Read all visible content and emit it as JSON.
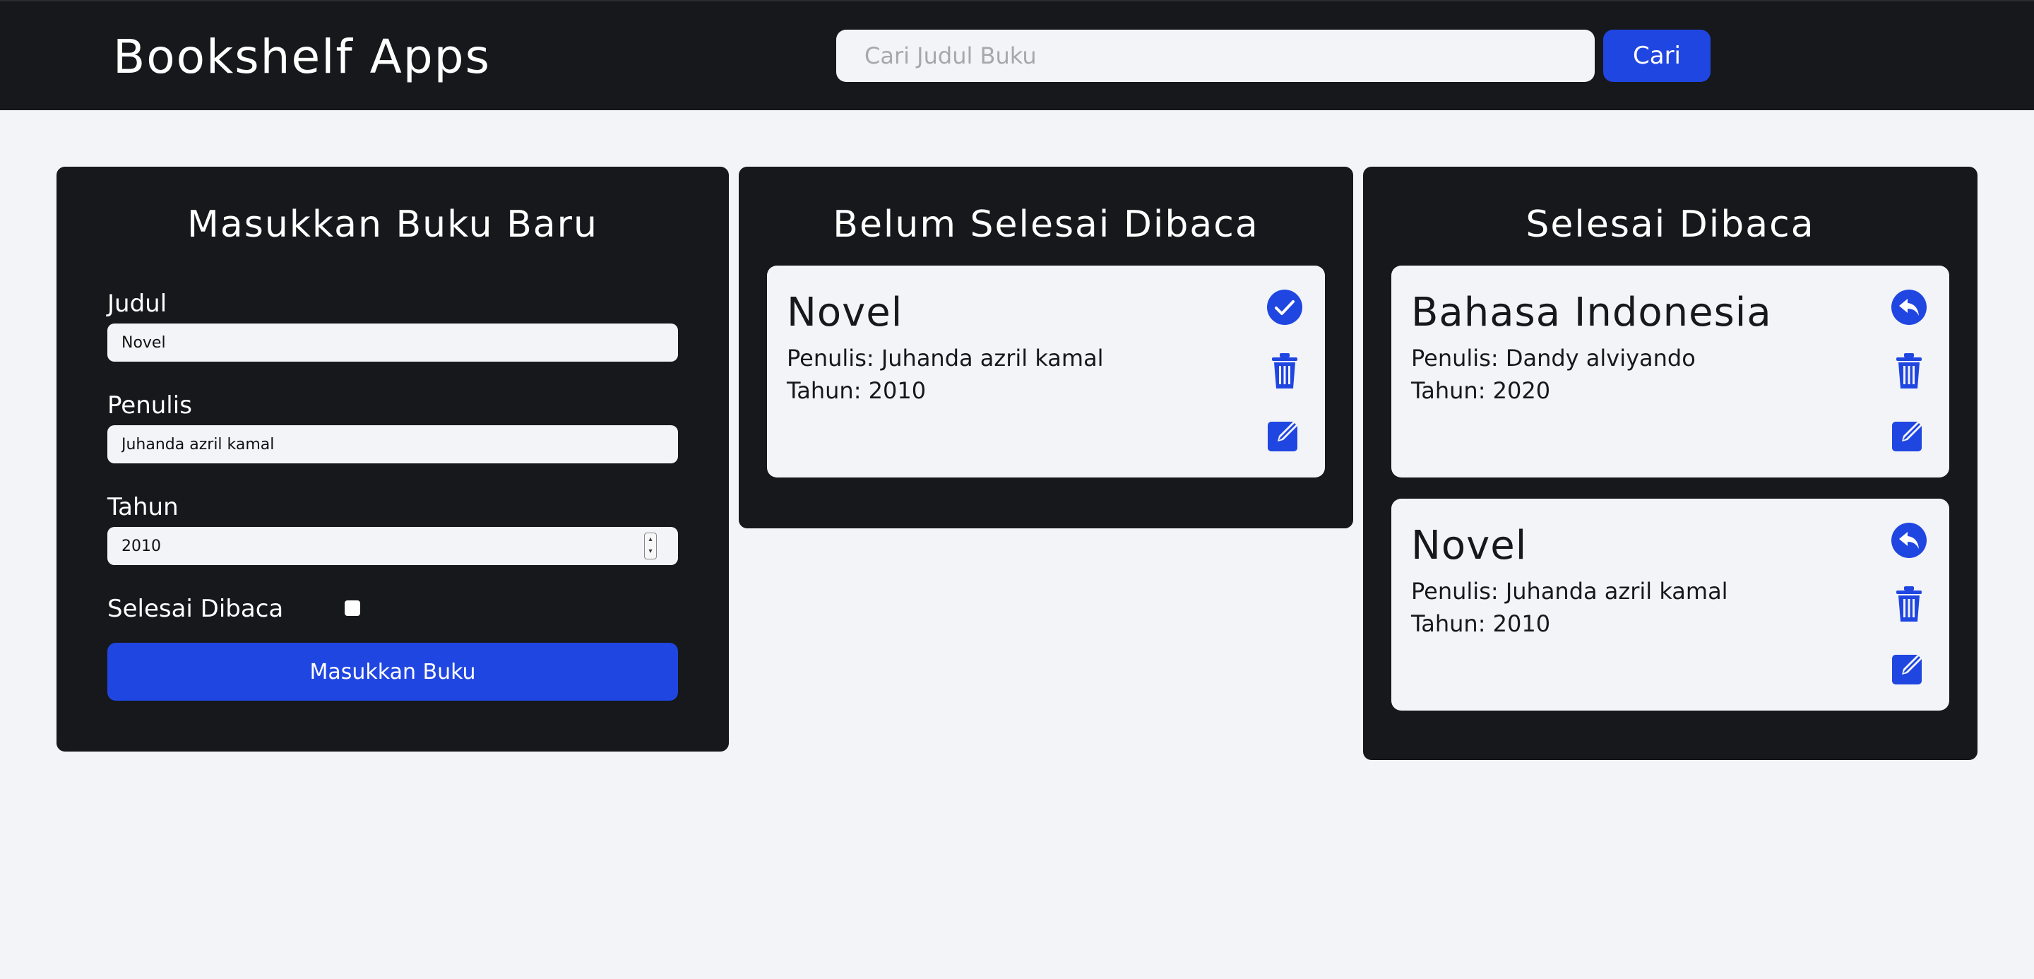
{
  "header": {
    "title": "Bookshelf Apps",
    "search_placeholder": "Cari Judul Buku",
    "search_button": "Cari"
  },
  "form": {
    "title": "Masukkan Buku Baru",
    "judul_label": "Judul",
    "judul_value": "Novel",
    "penulis_label": "Penulis",
    "penulis_value": "Juhanda azril kamal",
    "tahun_label": "Tahun",
    "tahun_value": "2010",
    "selesai_label": "Selesai Dibaca",
    "selesai_checked": false,
    "submit_label": "Masukkan Buku"
  },
  "unread": {
    "title": "Belum Selesai Dibaca",
    "books": [
      {
        "title": "Novel",
        "author": "Penulis: Juhanda azril kamal",
        "year": "Tahun: 2010"
      }
    ]
  },
  "read": {
    "title": "Selesai Dibaca",
    "books": [
      {
        "title": "Bahasa Indonesia",
        "author": "Penulis: Dandy alviyando",
        "year": "Tahun: 2020"
      },
      {
        "title": "Novel",
        "author": "Penulis: Juhanda azril kamal",
        "year": "Tahun: 2010"
      }
    ]
  },
  "icons": {
    "complete": "check-circle-icon",
    "undo": "undo-circle-icon",
    "delete": "trash-icon",
    "edit": "edit-icon"
  },
  "colors": {
    "accent": "#2046e2",
    "dark": "#17181b",
    "light": "#f3f4f8"
  }
}
